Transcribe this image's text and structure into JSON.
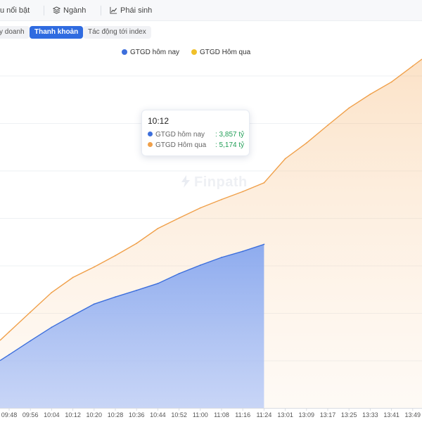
{
  "topbar": {
    "items": [
      {
        "label": "u nổi bật",
        "icon": "none"
      },
      {
        "label": "Ngành",
        "icon": "layers-icon"
      },
      {
        "label": "Phái sinh",
        "icon": "chart-line-icon"
      }
    ]
  },
  "subtabs": [
    {
      "label": "y doanh",
      "active": false
    },
    {
      "label": "Thanh khoản",
      "active": true
    },
    {
      "label": "Tác động tới index",
      "active": false
    }
  ],
  "watermark": "Finpath",
  "colors": {
    "today": "#3d6fdc",
    "yesterday": "#f0a04a",
    "legend_yesterday": "#f0c02a",
    "accent": "#2f6be0",
    "value_green": "#1f9d55"
  },
  "tooltip": {
    "time": "10:12",
    "rows": [
      {
        "label": "GTGD hôm nay",
        "value": ": 3,857 tỷ",
        "color": "#3d6fdc"
      },
      {
        "label": "GTGD Hôm qua",
        "value": ": 5,174 tỷ",
        "color": "#f0a04a"
      }
    ]
  },
  "chart_data": {
    "type": "area",
    "title": "",
    "xlabel": "",
    "ylabel": "",
    "categories": [
      "09:48",
      "09:56",
      "10:04",
      "10:12",
      "10:20",
      "10:28",
      "10:36",
      "10:44",
      "10:52",
      "11:00",
      "11:08",
      "11:16",
      "11:24",
      "13:01",
      "13:09",
      "13:17",
      "13:25",
      "13:33",
      "13:41",
      "13:49"
    ],
    "legend_placement": "top-center",
    "series": [
      {
        "name": "GTGD hôm nay",
        "color": "#3d6fdc",
        "legend_color": "#3d6fdc",
        "values": [
          3019,
          3314,
          3604,
          3857,
          4101,
          4253,
          4394,
          4540,
          4752,
          4932,
          5098,
          5228,
          5377
        ]
      },
      {
        "name": "GTGD Hôm qua",
        "color": "#f0a04a",
        "legend_color": "#f0c02a",
        "values": [
          3505,
          3928,
          4348,
          4669,
          4894,
          5137,
          5399,
          5716,
          5940,
          6157,
          6337,
          6506,
          6693,
          7209,
          7545,
          7923,
          8292,
          8586,
          8848,
          9189
        ]
      }
    ],
    "ylim": [
      1880,
      10000
    ],
    "grid": true
  }
}
